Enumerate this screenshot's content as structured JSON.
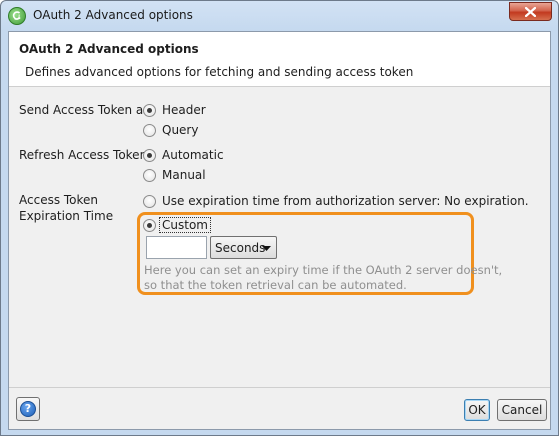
{
  "window": {
    "title": "OAuth 2 Advanced options"
  },
  "header": {
    "title": "OAuth 2 Advanced options",
    "description": "Defines advanced options for fetching and sending access token"
  },
  "send_access_token": {
    "label": "Send Access Token as:",
    "options": [
      {
        "label": "Header",
        "selected": true
      },
      {
        "label": "Query",
        "selected": false
      }
    ]
  },
  "refresh_access_token": {
    "label": "Refresh Access Token:",
    "options": [
      {
        "label": "Automatic",
        "selected": true
      },
      {
        "label": "Manual",
        "selected": false
      }
    ]
  },
  "expiration_time": {
    "label_line1": "Access Token",
    "label_line2": "Expiration Time",
    "options": [
      {
        "label": "Use expiration time from authorization server: No expiration.",
        "selected": false
      },
      {
        "label": "Custom",
        "selected": true
      }
    ],
    "custom_value": "",
    "unit": "Seconds",
    "hint_line1": "Here you can set an expiry time if the OAuth 2 server doesn't,",
    "hint_line2": "so that the token retrieval can be automated.",
    "highlight_color": "#f0901e"
  },
  "footer": {
    "help_label": "?",
    "ok_label": "OK",
    "cancel_label": "Cancel"
  }
}
